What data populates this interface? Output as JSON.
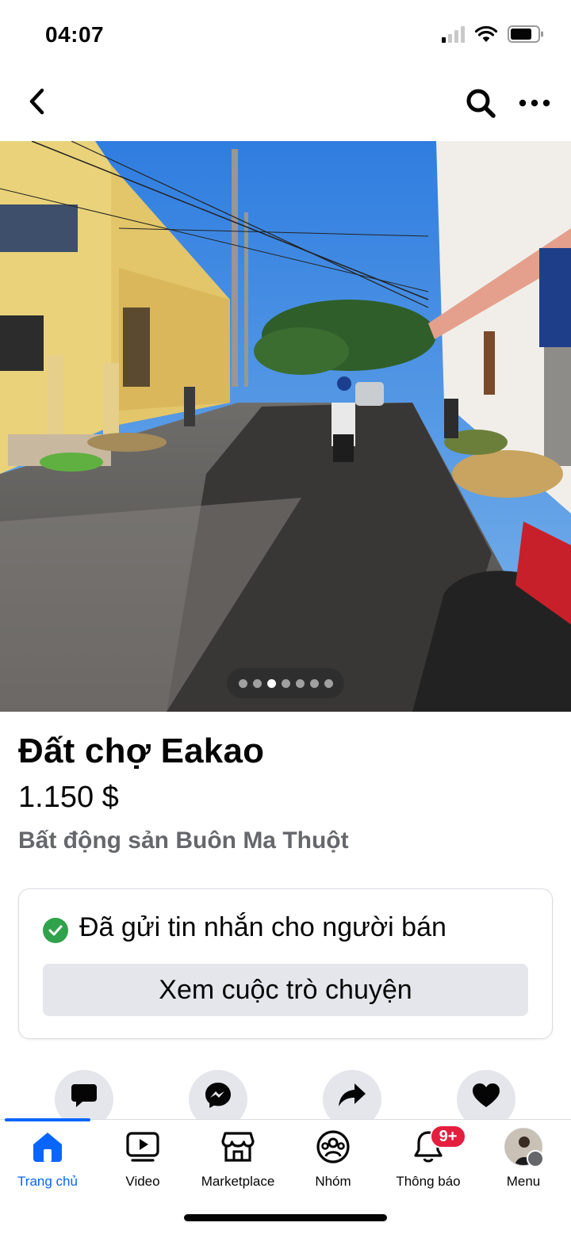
{
  "status_bar": {
    "time": "04:07"
  },
  "listing": {
    "title": "Đất chợ Eakao",
    "price": "1.150 $",
    "category_location": "Bất động sản Buôn Ma Thuột",
    "photo_count": 7,
    "active_photo_index": 2
  },
  "message_card": {
    "sent_text": "Đã gửi tin nhắn cho người bán",
    "view_chat_label": "Xem cuộc trò chuyện"
  },
  "actions": [
    "message-icon",
    "messenger-icon",
    "share-icon",
    "heart-icon"
  ],
  "tabs": [
    {
      "label": "Trang chủ",
      "icon": "home-icon",
      "active": true
    },
    {
      "label": "Video",
      "icon": "video-icon"
    },
    {
      "label": "Marketplace",
      "icon": "marketplace-icon"
    },
    {
      "label": "Nhóm",
      "icon": "groups-icon"
    },
    {
      "label": "Thông báo",
      "icon": "bell-icon",
      "badge": "9+"
    },
    {
      "label": "Menu",
      "icon": "avatar"
    }
  ],
  "colors": {
    "accent": "#0866ff",
    "badge": "#e41e3f",
    "success": "#31a24c",
    "secondary_text": "#65676b",
    "button_bg": "#e4e6eb"
  }
}
